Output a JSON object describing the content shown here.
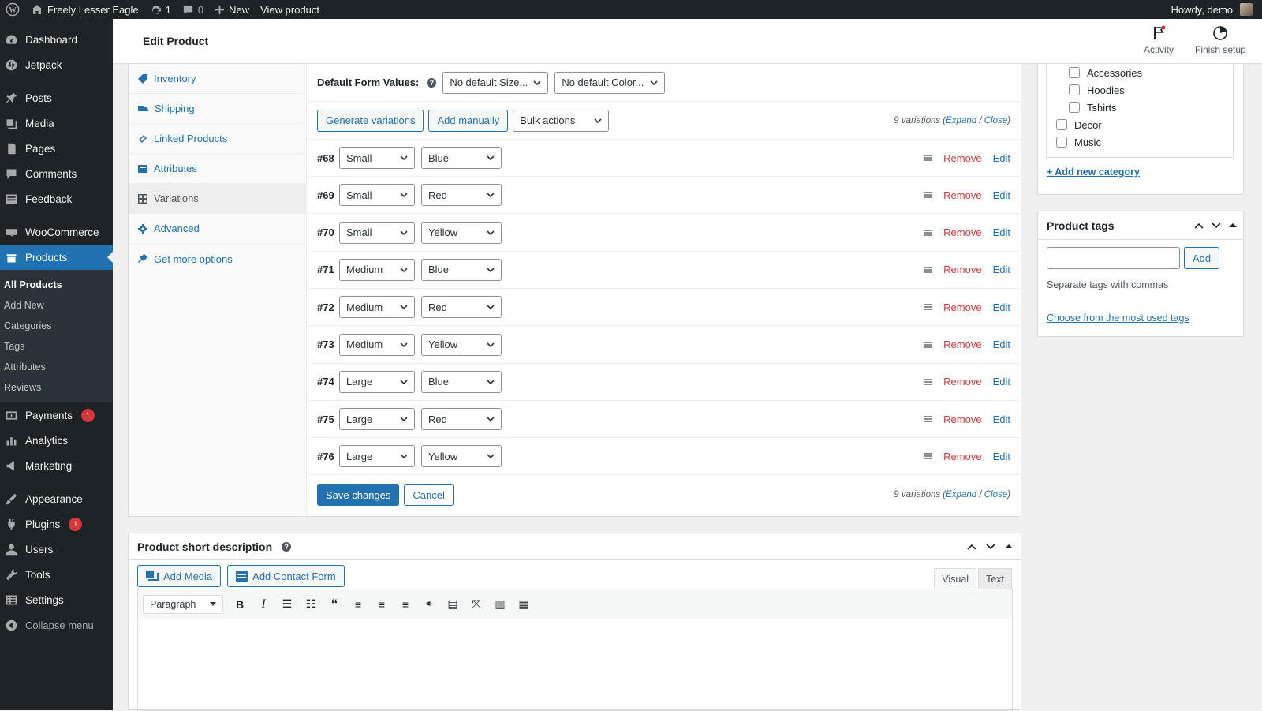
{
  "adminbar": {
    "site": "Freely Lesser Eagle",
    "updates": "1",
    "comments": "0",
    "new": "New",
    "view": "View product",
    "howdy": "Howdy, demo"
  },
  "sidebar": {
    "items": [
      {
        "label": "Dashboard",
        "icon": "dashboard-icon"
      },
      {
        "label": "Jetpack",
        "icon": "jetpack-icon"
      },
      {
        "label": "Posts",
        "icon": "pin-icon"
      },
      {
        "label": "Media",
        "icon": "media-icon"
      },
      {
        "label": "Pages",
        "icon": "pages-icon"
      },
      {
        "label": "Comments",
        "icon": "comment-icon"
      },
      {
        "label": "Feedback",
        "icon": "feedback-icon"
      },
      {
        "label": "WooCommerce",
        "icon": "woo-icon"
      },
      {
        "label": "Products",
        "icon": "products-icon"
      },
      {
        "label": "Payments",
        "icon": "payments-icon",
        "badge": "1"
      },
      {
        "label": "Analytics",
        "icon": "analytics-icon"
      },
      {
        "label": "Marketing",
        "icon": "marketing-icon"
      },
      {
        "label": "Appearance",
        "icon": "appearance-icon"
      },
      {
        "label": "Plugins",
        "icon": "plugins-icon",
        "badge": "1"
      },
      {
        "label": "Users",
        "icon": "users-icon"
      },
      {
        "label": "Tools",
        "icon": "tools-icon"
      },
      {
        "label": "Settings",
        "icon": "settings-icon"
      }
    ],
    "submenu": [
      "All Products",
      "Add New",
      "Categories",
      "Tags",
      "Attributes",
      "Reviews"
    ],
    "collapse": "Collapse menu"
  },
  "header": {
    "title": "Edit Product",
    "activity": "Activity",
    "finish": "Finish setup"
  },
  "tabs": [
    "Inventory",
    "Shipping",
    "Linked Products",
    "Attributes",
    "Variations",
    "Advanced",
    "Get more options"
  ],
  "variations": {
    "default_label": "Default Form Values:",
    "default_size": "No default Size...",
    "default_color": "No default Color...",
    "generate": "Generate variations",
    "add_manually": "Add manually",
    "bulk": "Bulk actions",
    "count_text": "9 variations (",
    "expand": "Expand",
    "slash": " / ",
    "close": "Close",
    "count_end": ")",
    "remove": "Remove",
    "edit": "Edit",
    "save": "Save changes",
    "cancel": "Cancel",
    "rows": [
      {
        "id": "#68",
        "size": "Small",
        "color": "Blue"
      },
      {
        "id": "#69",
        "size": "Small",
        "color": "Red"
      },
      {
        "id": "#70",
        "size": "Small",
        "color": "Yellow"
      },
      {
        "id": "#71",
        "size": "Medium",
        "color": "Blue"
      },
      {
        "id": "#72",
        "size": "Medium",
        "color": "Red"
      },
      {
        "id": "#73",
        "size": "Medium",
        "color": "Yellow"
      },
      {
        "id": "#74",
        "size": "Large",
        "color": "Blue"
      },
      {
        "id": "#75",
        "size": "Large",
        "color": "Red"
      },
      {
        "id": "#76",
        "size": "Large",
        "color": "Yellow"
      }
    ]
  },
  "categories": {
    "sub": [
      "Accessories",
      "Hoodies",
      "Tshirts"
    ],
    "top": [
      "Decor",
      "Music"
    ],
    "add": "+ Add new category"
  },
  "tags": {
    "title": "Product tags",
    "add": "Add",
    "hint": "Separate tags with commas",
    "choose": "Choose from the most used tags"
  },
  "short_desc": {
    "title": "Product short description",
    "add_media": "Add Media",
    "add_form": "Add Contact Form",
    "visual": "Visual",
    "text": "Text",
    "format": "Paragraph"
  }
}
